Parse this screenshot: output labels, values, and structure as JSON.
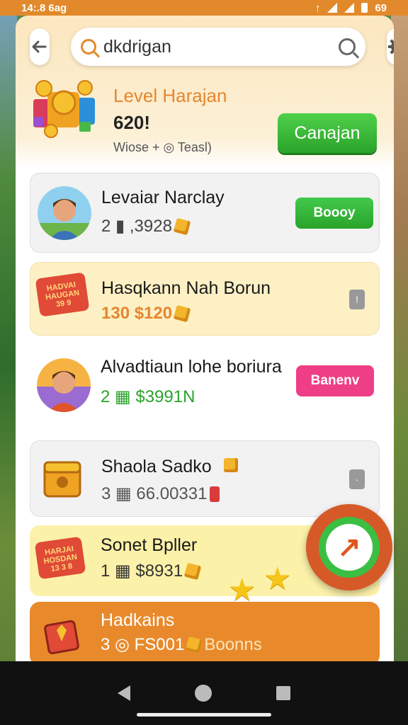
{
  "status_bar": {
    "time": "14:.8 6ag",
    "battery": "69"
  },
  "topbar": {
    "search_value": "dkdrigan"
  },
  "level": {
    "title": "Level Harajan",
    "value": "620!",
    "subtitle": "Wiose + ◎ Teasl)",
    "button_label": "Canajan"
  },
  "items": [
    {
      "title": "Levaiar Narclay",
      "meta": "2 ▮ ,3928",
      "action": "Boooy",
      "action_color": "#2fb33a"
    },
    {
      "title": "Hasqkann Nah Borun",
      "meta": "130 $120",
      "action": ""
    },
    {
      "title": "Alvadtiaun lohe boriura",
      "meta": "2 ▦ $3991N",
      "action": "Banenv",
      "action_color": "#ee3f86"
    },
    {
      "title": "Shaola Sadko",
      "meta": "3 ▦ 66.00331",
      "action": ""
    },
    {
      "title": "Sonet Bpller",
      "meta": "1 ▦ $8931",
      "action": ""
    },
    {
      "title": "Hadkains",
      "meta": "3 ◎ FS001",
      "extra": "Boonns",
      "action": ""
    }
  ],
  "badges": {
    "red_badge_1": "HADVAI HAUGAN",
    "red_badge_1_num": "39 9",
    "red_badge_2": "HARJAI HOSDAN",
    "red_badge_2_num": "13 3 8"
  },
  "colors": {
    "accent": "#e6862e",
    "primary_green": "#2fb33a",
    "pink": "#ee3f86",
    "status": "#e28a2b"
  },
  "icons": [
    "back-arrow-icon",
    "search-icon",
    "clear-search-icon",
    "gear-icon",
    "play-arrow-icon"
  ]
}
